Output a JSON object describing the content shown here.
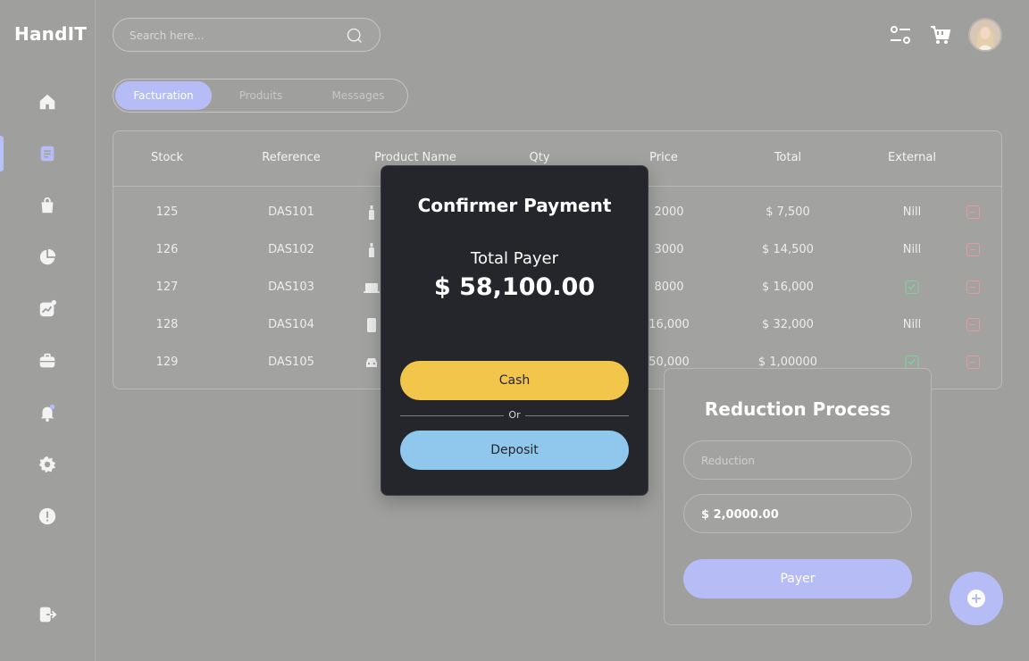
{
  "app": {
    "logo": "HandIT"
  },
  "header": {
    "search_placeholder": "Search here..."
  },
  "tabs": [
    {
      "label": "Facturation",
      "active": true
    },
    {
      "label": "Produits",
      "active": false
    },
    {
      "label": "Messages",
      "active": false
    }
  ],
  "table": {
    "columns": [
      "Stock",
      "Reference",
      "Product Name",
      "Qty",
      "Price",
      "Total",
      "External"
    ],
    "rows": [
      {
        "stock": "125",
        "reference": "DAS101",
        "product_icon": "bottle-icon",
        "price": "2000",
        "total": "$ 7,500",
        "external": "Nill"
      },
      {
        "stock": "126",
        "reference": "DAS102",
        "product_icon": "bottle-icon",
        "price": "3000",
        "total": "$ 14,500",
        "external": "Nill"
      },
      {
        "stock": "127",
        "reference": "DAS103",
        "product_icon": "laptop-icon",
        "price": "8000",
        "total": "$ 16,000",
        "external": "check"
      },
      {
        "stock": "128",
        "reference": "DAS104",
        "product_icon": "phone-icon",
        "price": "16,000",
        "total": "$ 32,000",
        "external": "Nill"
      },
      {
        "stock": "129",
        "reference": "DAS105",
        "product_icon": "car-icon",
        "price": "50,000",
        "total": "$ 1,00000",
        "external": "check"
      }
    ]
  },
  "confirm_modal": {
    "title": "Confirmer Payment",
    "total_label": "Total Payer",
    "total_value": "$ 58,100.00",
    "cash_label": "Cash",
    "or_label": "Or",
    "deposit_label": "Deposit"
  },
  "reduction": {
    "title": "Reduction Process",
    "reduction_placeholder": "Reduction",
    "amount_value": "$ 2,0000.00",
    "pay_label": "Payer"
  },
  "colors": {
    "accent": "#b6bdf6",
    "cash": "#f2c64a",
    "deposit": "#8fc8ec",
    "modal_bg": "#25262b",
    "danger": "#e69a9a",
    "success": "#7fd19a"
  }
}
